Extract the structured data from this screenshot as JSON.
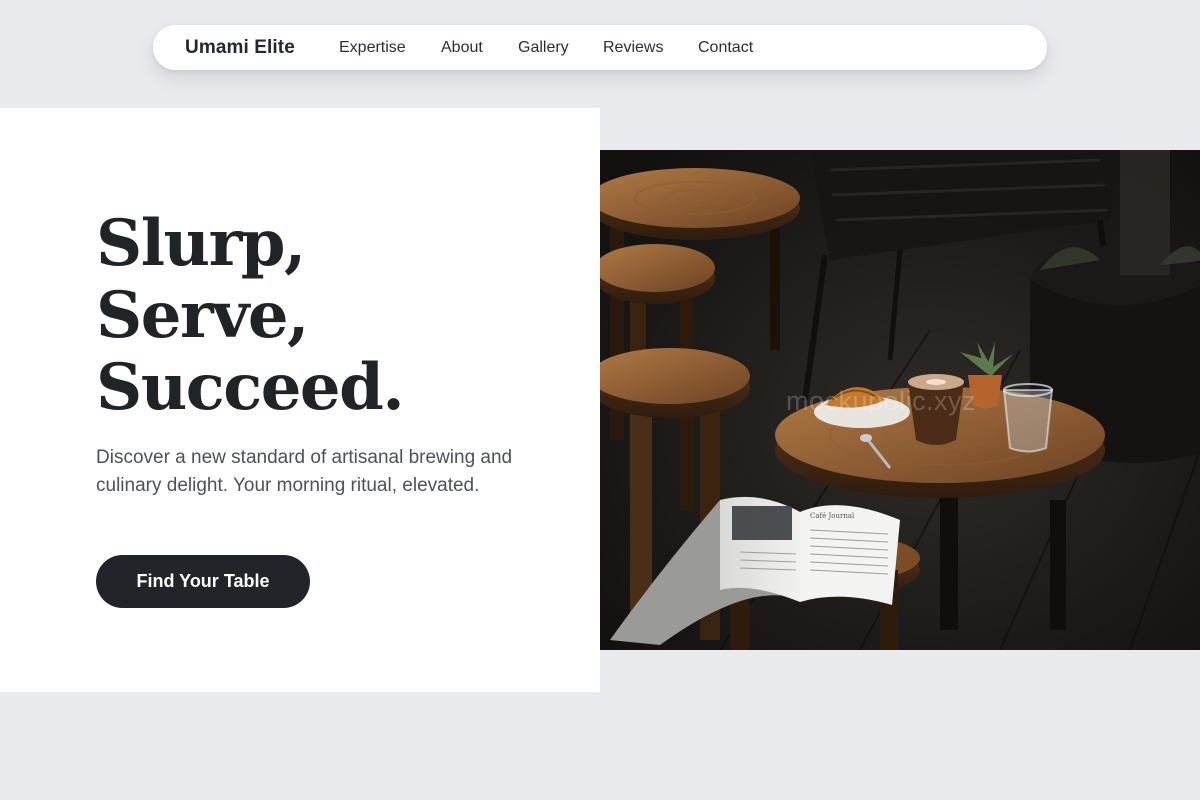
{
  "nav": {
    "brand": "Umami Elite",
    "links": [
      "Expertise",
      "About",
      "Gallery",
      "Reviews",
      "Contact"
    ]
  },
  "hero": {
    "headline": [
      "Slurp,",
      "Serve,",
      "Succeed."
    ],
    "subtitle": "Discover a new standard of artisanal brewing and culinary delight. Your morning ritual, elevated.",
    "cta_label": "Find Your Table"
  },
  "photo": {
    "watermark": "mockupolic.xyz",
    "magazine_title": "Café Journal"
  },
  "colors": {
    "page_bg": "#e9eaed",
    "card_bg": "#ffffff",
    "text_dark": "#212427",
    "cta_bg": "#212529",
    "wood": "#8a5a33"
  }
}
